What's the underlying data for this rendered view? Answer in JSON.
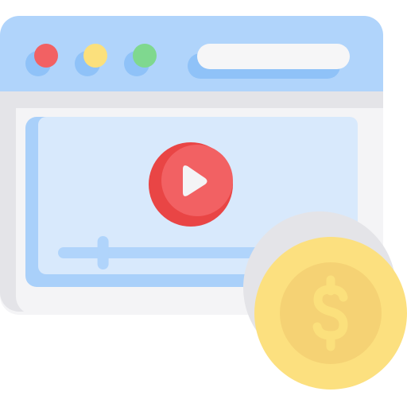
{
  "colors": {
    "titlebar": "#b0d4fb",
    "titlebar_shadow": "#8fc2f8",
    "window_body": "#f4f4f6",
    "window_body_shadow": "#e4e4e8",
    "video_area": "#d8e9fc",
    "video_area_shadow": "#a9d0fa",
    "dot_red": "#f26163",
    "dot_yellow": "#fbe07c",
    "dot_green": "#7fd88f",
    "address_bar": "#f6f6f7",
    "play_button": "#f26163",
    "play_button_shadow": "#e94545",
    "play_triangle": "#f4f4f6",
    "progress_track": "#b0d4fb",
    "coin_outer": "#fce07f",
    "coin_inner": "#f5d274",
    "coin_symbol": "#fbe07c"
  },
  "icons": {
    "window": "browser-window-icon",
    "play": "play-icon",
    "coin": "dollar-coin-icon"
  },
  "video": {
    "progress": 0.16
  },
  "coin": {
    "symbol": "$"
  }
}
